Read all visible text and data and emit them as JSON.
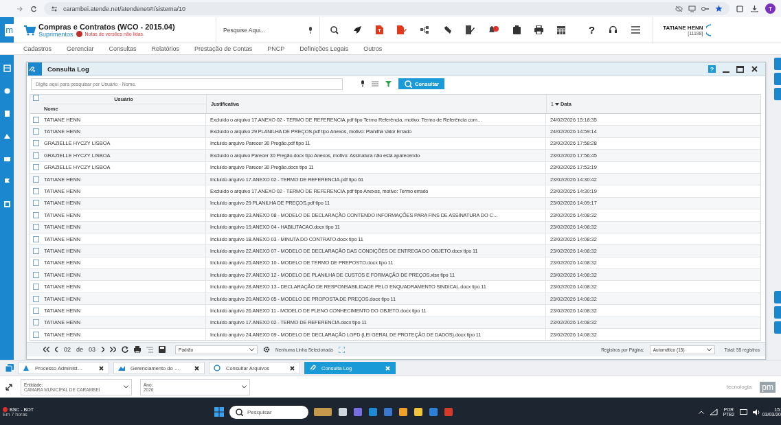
{
  "browser": {
    "url": "carambei.atende.net/atendenet#!/sistema/10",
    "profile_letter": "T"
  },
  "header": {
    "logo_text": "m",
    "title": "Compras e Contratos (WCO - 2015.04)",
    "subtitle": "Suprimentos",
    "notes": "Notas de versões não lidas.",
    "search_placeholder": "Pesquise Aqui...",
    "help_label": "?",
    "user_name": "TATIANE HENN",
    "user_code": "[11198]"
  },
  "menu": [
    "Cadastros",
    "Gerenciar",
    "Consultas",
    "Relatórios",
    "Prestação de Contas",
    "PNCP",
    "Definições Legais",
    "Outros"
  ],
  "window": {
    "title": "Consulta Log",
    "help_label": "?",
    "search_placeholder": "Digite aqui para pesquisar por Usuário - Nome.",
    "search_button": "Consultar",
    "table": {
      "all_checked": false,
      "group_header": "Usuário",
      "columns": [
        "Nome",
        "Justificativa",
        "Data"
      ],
      "sort_order": "1",
      "rows": [
        {
          "checked": false,
          "name": "TATIANE HENN",
          "text": "Excluído o arquivo 17.ANEXO 02 - TERMO DE REFERENCIA.pdf tipo Termo Referência, motivo: Termo de Referência com…",
          "date": "24/02/2026 15:18:35"
        },
        {
          "checked": false,
          "name": "TATIANE HENN",
          "text": "Excluído o arquivo 29 PLANILHA DE PREÇOS.pdf tipo Anexos, motivo: Planilha Valor Errado",
          "date": "24/02/2026 14:59:14"
        },
        {
          "checked": false,
          "name": "GRAZIELLE HYCZY LISBOA",
          "text": "Incluído arquivo Parecer 30 Pregão.pdf tipo 11",
          "date": "23/02/2026 17:58:28"
        },
        {
          "checked": false,
          "name": "GRAZIELLE HYCZY LISBOA",
          "text": "Excluído o arquivo Parecer 30 Pregão.docx tipo Anexos, motivo: Assinatura não está aparecendo",
          "date": "23/02/2026 17:56:45"
        },
        {
          "checked": false,
          "name": "GRAZIELLE HYCZY LISBOA",
          "text": "Incluído arquivo Parecer 30 Pregão.docx tipo 11",
          "date": "23/02/2026 17:53:19"
        },
        {
          "checked": false,
          "name": "TATIANE HENN",
          "text": "Incluído arquivo 17.ANEXO 02 - TERMO DE REFERENCIA.pdf tipo 61",
          "date": "23/02/2026 14:30:42"
        },
        {
          "checked": false,
          "name": "TATIANE HENN",
          "text": "Excluído o arquivo 17.ANEXO 02 - TERMO DE REFERENCIA.pdf tipo Anexos, motivo: Termo errado",
          "date": "23/02/2026 14:30:19"
        },
        {
          "checked": false,
          "name": "TATIANE HENN",
          "text": "Incluído arquivo 29 PLANILHA DE PREÇOS.pdf tipo 11",
          "date": "23/02/2026 14:09:17"
        },
        {
          "checked": false,
          "name": "TATIANE HENN",
          "text": "Incluído arquivo 23.ANEXO 08 - MODELO DE DECLARAÇÃO CONTENDO INFORMAÇÕES PARA FINS DE ASSINATURA DO C…",
          "date": "23/02/2026 14:08:32"
        },
        {
          "checked": false,
          "name": "TATIANE HENN",
          "text": "Incluído arquivo 19.ANEXO 04 - HABILITACAO.docx tipo 11",
          "date": "23/02/2026 14:08:32"
        },
        {
          "checked": false,
          "name": "TATIANE HENN",
          "text": "Incluído arquivo 18.ANEXO 03 - MINUTA DO CONTRATO.docx tipo 11",
          "date": "23/02/2026 14:08:32"
        },
        {
          "checked": false,
          "name": "TATIANE HENN",
          "text": "Incluído arquivo 22.ANEXO 07 - MODELO DE DECLARAÇÃO DAS CONDIÇÕES DE ENTREGA DO OBJETO.docx tipo 11",
          "date": "23/02/2026 14:08:32"
        },
        {
          "checked": false,
          "name": "TATIANE HENN",
          "text": "Incluído arquivo 25.ANEXO 10 - MODELO DE TERMO DE PREPOSTO.docx tipo 11",
          "date": "23/02/2026 14:08:32"
        },
        {
          "checked": false,
          "name": "TATIANE HENN",
          "text": "Incluído arquivo 27.ANEXO 12 - MODELO DE PLANILHA DE CUSTOS E FORMAÇÃO DE PREÇOS.xlsx tipo 11",
          "date": "23/02/2026 14:08:32"
        },
        {
          "checked": false,
          "name": "TATIANE HENN",
          "text": "Incluído arquivo 28.ANEXO 13 - DECLARAÇÃO DE RESPONSABILIDADE PELO ENQUADRAMENTO SINDICAL.docx tipo 11",
          "date": "23/02/2026 14:08:32"
        },
        {
          "checked": false,
          "name": "TATIANE HENN",
          "text": "Incluído arquivo 20.ANEXO 05 - MODELO DE PROPOSTA DE PREÇOS.docx tipo 11",
          "date": "23/02/2026 14:08:32"
        },
        {
          "checked": false,
          "name": "TATIANE HENN",
          "text": "Incluído arquivo 26.ANEXO 11 - MODELO DE PLENO CONHECIMENTO DO OBJETO.docx tipo 11",
          "date": "23/02/2026 14:08:32"
        },
        {
          "checked": false,
          "name": "TATIANE HENN",
          "text": "Incluído arquivo 17.ANEXO 02 - TERMO DE REFERENCIA.docx tipo 11",
          "date": "23/02/2026 14:08:32"
        },
        {
          "checked": false,
          "name": "TATIANE HENN",
          "text": "Incluído arquivo 24.ANEXO 09 - MODELO DE DECLARAÇÃO LGPD (LEI GERAL DE PROTEÇÃO DE DADOS).docx tipo 11",
          "date": "23/02/2026 14:08:32"
        }
      ]
    },
    "pager": {
      "page": "02",
      "of": "de",
      "total_pages": "03",
      "layout": "Padrão",
      "selection": "Nenhuma Linha Selecionada",
      "per_page_label": "Registros por Página:",
      "per_page": "Automático (15)",
      "total": "Total: 55 registros"
    }
  },
  "tabs": [
    {
      "label": "Processo Administ…",
      "selected": false
    },
    {
      "label": "Gerenciamento do …",
      "selected": false
    },
    {
      "label": "Consultar Arquivos",
      "selected": false
    },
    {
      "label": "Consulta Log",
      "selected": true
    }
  ],
  "filters": [
    {
      "label": "Entidade:",
      "value": "CAMARA MUNICIPAL DE CARAMBEI"
    },
    {
      "label": "Ano:",
      "value": "2026"
    }
  ],
  "brand": {
    "text": "tecnologia",
    "mark": "pm"
  },
  "taskbar": {
    "weather_title": "BSC - BOT",
    "weather_sub": "Em 7 horas",
    "search_placeholder": "Pesquisar",
    "lang": "POR",
    "layout": "PTB2",
    "time": "15:",
    "date": "03/03/20"
  }
}
